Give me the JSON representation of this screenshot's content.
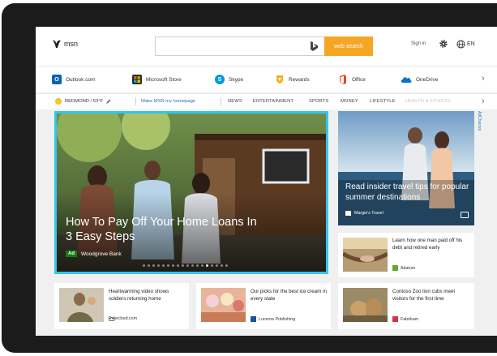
{
  "header": {
    "logo_text": "msn",
    "search_placeholder": "",
    "search_button": "web search",
    "signin": "Sign in",
    "language": "EN"
  },
  "apps": [
    {
      "label": "Outlook.com",
      "color": "#0a64ad",
      "icon": "outlook-icon"
    },
    {
      "label": "Microsoft Store",
      "color": "#2b2b2b",
      "icon": "store-icon"
    },
    {
      "label": "Skype",
      "color": "#0098e0",
      "icon": "skype-icon"
    },
    {
      "label": "Rewards",
      "color": "#f5b01a",
      "icon": "rewards-icon"
    },
    {
      "label": "Office",
      "color": "#e24a1f",
      "icon": "office-icon"
    },
    {
      "label": "OneDrive",
      "color": "#0f6fcb",
      "icon": "onedrive-icon"
    }
  ],
  "navbar": {
    "weather": "REDMOND / 53°F",
    "homepage": "Make MSN my homepage",
    "items": [
      "NEWS",
      "ENTERTAINMENT",
      "SPORTS",
      "MONEY",
      "LIFESTYLE",
      "HEALTH & FITNESS"
    ]
  },
  "hero": {
    "title": "How To Pay Off Your Home Loans In 3 Easy Steps",
    "ad_label": "Ad",
    "source": "Woodgrove Bank",
    "slide_count": 18,
    "active_slide": 13
  },
  "side_hero": {
    "title": "Read insider travel tips for popular summer destinations",
    "source": "Margie's Travel"
  },
  "adchoices": "AdChoices",
  "cards": [
    {
      "text": "Learn how one man paid off his debt and retired early",
      "source": "Adatum",
      "source_color": "#5fa83b"
    },
    {
      "text": "Heartwarming video shows soldiers returning home",
      "source": "Relecloud.com",
      "source_color": "#444444"
    },
    {
      "text": "Our picks for the best ice cream in every state",
      "source": "Lucerne Publishing",
      "source_color": "#1d4f9a"
    },
    {
      "text": "Contoso Zoo lion cubs meet visitors for the first time",
      "source": "Fabrikam",
      "source_color": "#d8304d"
    }
  ],
  "colors": {
    "accent": "#2fc7ee",
    "search_button": "#f5a623",
    "link": "#2a6ebb",
    "ad_badge": "#107c10"
  }
}
